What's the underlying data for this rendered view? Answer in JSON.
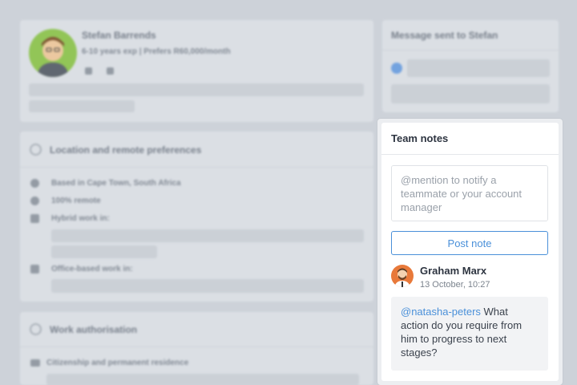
{
  "profile": {
    "name": "Stefan Barrends",
    "meta": "6-10 years exp | Prefers R60,000/month"
  },
  "message_card": {
    "title": "Message sent to Stefan"
  },
  "location_card": {
    "title": "Location and remote preferences",
    "items": [
      "Based in Cape Town, South Africa",
      "100% remote",
      "Hybrid work in:",
      "Office-based work in:"
    ]
  },
  "authorisation_card": {
    "title": "Work authorisation",
    "items": [
      "Citizenship and permanent residence"
    ]
  },
  "team_notes": {
    "title": "Team notes",
    "input_placeholder": "@mention to notify a teammate or your account manager",
    "post_label": "Post note",
    "notes": [
      {
        "author": "Graham Marx",
        "time": "13 October, 10:27",
        "mention": "@natasha-peters",
        "text": " What action do you require from him to progress to next stages?"
      }
    ]
  },
  "colors": {
    "accent": "#4a90d9",
    "background": "#cdd2d9"
  }
}
